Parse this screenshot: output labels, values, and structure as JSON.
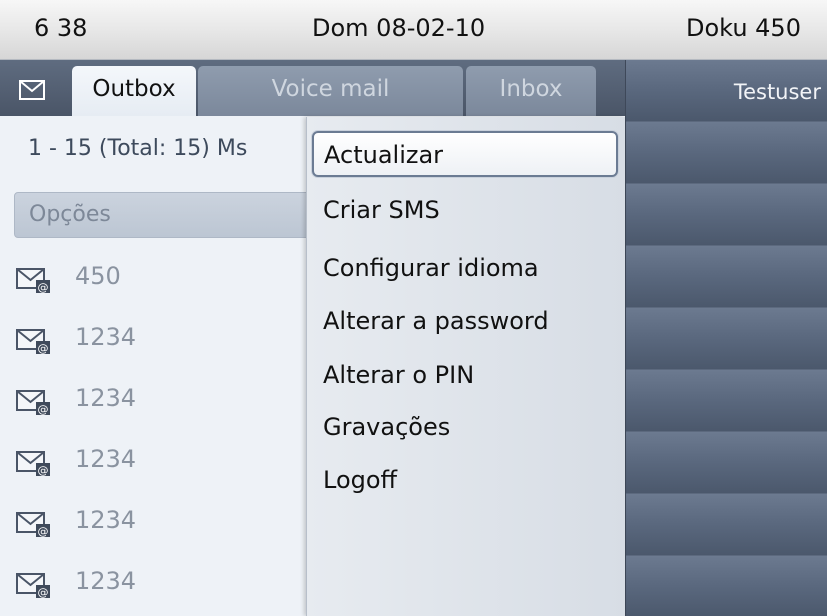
{
  "status_bar": {
    "time": "6 38",
    "date": "Dom 08-02-10",
    "user": "Doku 450"
  },
  "tabs": [
    {
      "label": "Outbox",
      "active": true
    },
    {
      "label": "Voice mail",
      "active": false
    },
    {
      "label": "Inbox",
      "active": false
    }
  ],
  "list": {
    "count_text": "1 - 15 (Total: 15) Ms",
    "options_label": "Opções",
    "messages": [
      {
        "sender": "450",
        "icon": "mail-attachment-icon"
      },
      {
        "sender": "1234",
        "icon": "mail-attachment-icon"
      },
      {
        "sender": "1234",
        "icon": "mail-attachment-icon"
      },
      {
        "sender": "1234",
        "icon": "mail-attachment-icon"
      },
      {
        "sender": "1234",
        "icon": "mail-attachment-icon"
      },
      {
        "sender": "1234",
        "icon": "mail-attachment-icon"
      }
    ]
  },
  "menu": {
    "items": [
      {
        "label": "Actualizar",
        "selected": true
      },
      {
        "label": "Criar SMS",
        "selected": false
      },
      {
        "label": "Configurar idioma",
        "selected": false
      },
      {
        "label": "Alterar a password",
        "selected": false
      },
      {
        "label": "Alterar o PIN",
        "selected": false
      },
      {
        "label": "Gravações",
        "selected": false
      },
      {
        "label": "Logoff",
        "selected": false
      }
    ]
  },
  "right_panel": {
    "contact": "Testuser"
  },
  "colors": {
    "tab_bar": "#4a5567",
    "active_tab": "#eef2f7",
    "menu_selection_border": "#6b7b93",
    "right_panel": "#5a687e"
  }
}
